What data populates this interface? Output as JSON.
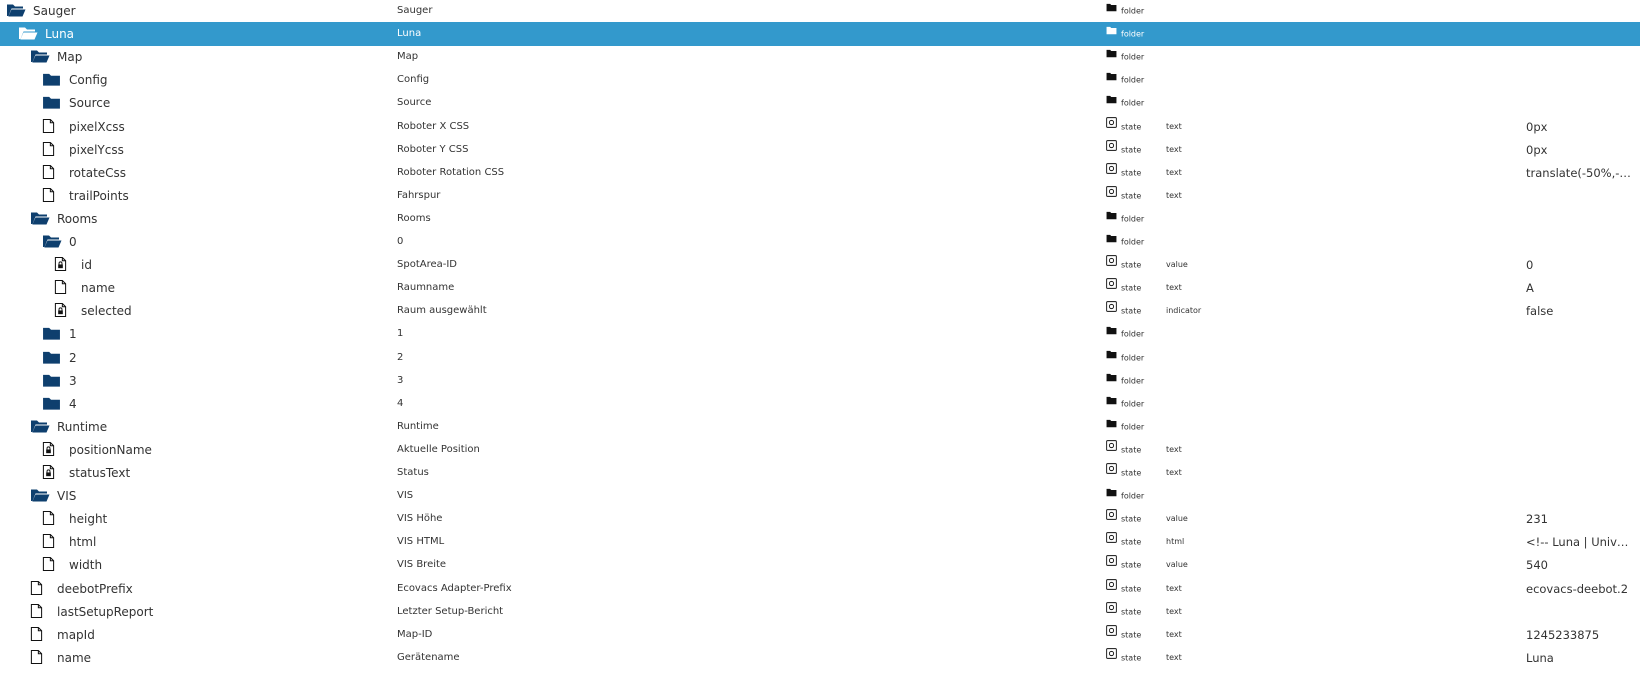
{
  "rows": [
    {
      "depth": 0,
      "icon": "folder-open-icon",
      "id": "Sauger",
      "name": "Sauger",
      "type": "folder",
      "role": "",
      "value": ""
    },
    {
      "depth": 1,
      "icon": "folder-open-icon",
      "id": "Luna",
      "name": "Luna",
      "type": "folder",
      "role": "",
      "value": "",
      "selected": true
    },
    {
      "depth": 2,
      "icon": "folder-open-icon",
      "id": "Map",
      "name": "Map",
      "type": "folder",
      "role": "",
      "value": ""
    },
    {
      "depth": 3,
      "icon": "folder-closed-icon",
      "id": "Config",
      "name": "Config",
      "type": "folder",
      "role": "",
      "value": ""
    },
    {
      "depth": 3,
      "icon": "folder-closed-icon",
      "id": "Source",
      "name": "Source",
      "type": "folder",
      "role": "",
      "value": ""
    },
    {
      "depth": 3,
      "icon": "file-icon",
      "id": "pixelXcss",
      "name": "Roboter X CSS",
      "type": "state",
      "role": "text",
      "value": "0px"
    },
    {
      "depth": 3,
      "icon": "file-icon",
      "id": "pixelYcss",
      "name": "Roboter Y CSS",
      "type": "state",
      "role": "text",
      "value": "0px"
    },
    {
      "depth": 3,
      "icon": "file-icon",
      "id": "rotateCss",
      "name": "Roboter Rotation CSS",
      "type": "state",
      "role": "text",
      "value": "translate(-50%,-5..."
    },
    {
      "depth": 3,
      "icon": "file-icon",
      "id": "trailPoints",
      "name": "Fahrspur",
      "type": "state",
      "role": "text",
      "value": ""
    },
    {
      "depth": 2,
      "icon": "folder-open-icon",
      "id": "Rooms",
      "name": "Rooms",
      "type": "folder",
      "role": "",
      "value": ""
    },
    {
      "depth": 3,
      "icon": "folder-open-icon",
      "id": "0",
      "name": "0",
      "type": "folder",
      "role": "",
      "value": ""
    },
    {
      "depth": 4,
      "icon": "file-locked-icon",
      "id": "id",
      "name": "SpotArea-ID",
      "type": "state",
      "role": "value",
      "value": "0"
    },
    {
      "depth": 4,
      "icon": "file-icon",
      "id": "name",
      "name": "Raumname",
      "type": "state",
      "role": "text",
      "value": "A"
    },
    {
      "depth": 4,
      "icon": "file-locked-icon",
      "id": "selected",
      "name": "Raum ausgewählt",
      "type": "state",
      "role": "indicator",
      "value": "false"
    },
    {
      "depth": 3,
      "icon": "folder-closed-icon",
      "id": "1",
      "name": "1",
      "type": "folder",
      "role": "",
      "value": ""
    },
    {
      "depth": 3,
      "icon": "folder-closed-icon",
      "id": "2",
      "name": "2",
      "type": "folder",
      "role": "",
      "value": ""
    },
    {
      "depth": 3,
      "icon": "folder-closed-icon",
      "id": "3",
      "name": "3",
      "type": "folder",
      "role": "",
      "value": ""
    },
    {
      "depth": 3,
      "icon": "folder-closed-icon",
      "id": "4",
      "name": "4",
      "type": "folder",
      "role": "",
      "value": ""
    },
    {
      "depth": 2,
      "icon": "folder-open-icon",
      "id": "Runtime",
      "name": "Runtime",
      "type": "folder",
      "role": "",
      "value": ""
    },
    {
      "depth": 3,
      "icon": "file-locked-icon",
      "id": "positionName",
      "name": "Aktuelle Position",
      "type": "state",
      "role": "text",
      "value": ""
    },
    {
      "depth": 3,
      "icon": "file-locked-icon",
      "id": "statusText",
      "name": "Status",
      "type": "state",
      "role": "text",
      "value": ""
    },
    {
      "depth": 2,
      "icon": "folder-open-icon",
      "id": "VIS",
      "name": "VIS",
      "type": "folder",
      "role": "",
      "value": ""
    },
    {
      "depth": 3,
      "icon": "file-icon",
      "id": "height",
      "name": "VIS Höhe",
      "type": "state",
      "role": "value",
      "value": "231"
    },
    {
      "depth": 3,
      "icon": "file-icon",
      "id": "html",
      "name": "VIS HTML",
      "type": "state",
      "role": "html",
      "value": "<!-- Luna | Univer..."
    },
    {
      "depth": 3,
      "icon": "file-icon",
      "id": "width",
      "name": "VIS Breite",
      "type": "state",
      "role": "value",
      "value": "540"
    },
    {
      "depth": 2,
      "icon": "file-icon",
      "id": "deebotPrefix",
      "name": "Ecovacs Adapter-Prefix",
      "type": "state",
      "role": "text",
      "value": "ecovacs-deebot.2"
    },
    {
      "depth": 2,
      "icon": "file-icon",
      "id": "lastSetupReport",
      "name": "Letzter Setup-Bericht",
      "type": "state",
      "role": "text",
      "value": ""
    },
    {
      "depth": 2,
      "icon": "file-icon",
      "id": "mapId",
      "name": "Map-ID",
      "type": "state",
      "role": "text",
      "value": "1245233875"
    },
    {
      "depth": 2,
      "icon": "file-icon",
      "id": "name",
      "name": "Gerätename",
      "type": "state",
      "role": "text",
      "value": "Luna"
    }
  ],
  "colors": {
    "selected_bg": "#3399cc",
    "folder_icon": "#0e3f6e",
    "file_icon": "#111111"
  }
}
